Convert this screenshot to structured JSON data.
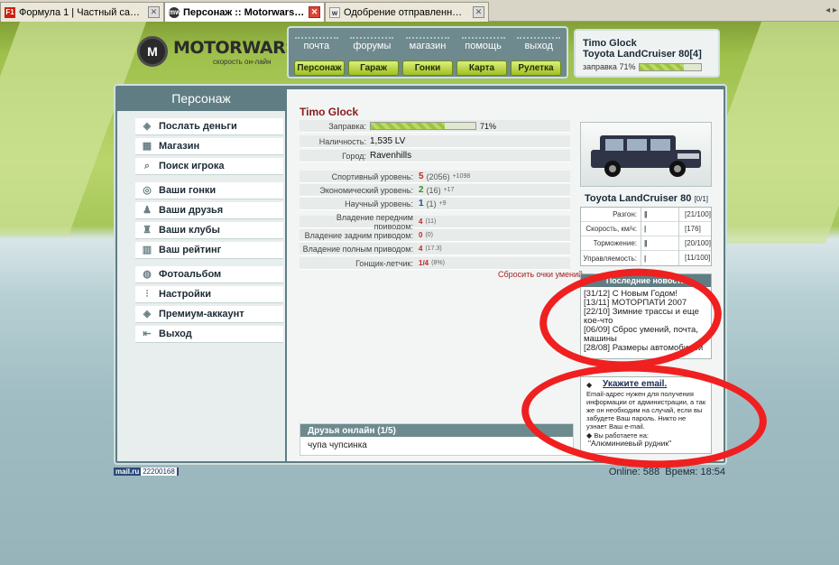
{
  "browser": {
    "tabs": [
      {
        "favicon": "F1",
        "title": "Формула 1 | Частный сайт о большин...",
        "active": false
      },
      {
        "favicon": "mw",
        "title": "Персонаж :: Motorwars.ru",
        "active": true
      },
      {
        "favicon": "w",
        "title": "Одобрение отправленных посетите...",
        "active": false
      }
    ],
    "tab_nav": "◂ ▸"
  },
  "logo": {
    "mark": "M",
    "title": "MOTORWARS.RU",
    "subtitle": "скорость он-лайн"
  },
  "topnav": {
    "links": [
      "почта",
      "форумы",
      "магазин",
      "помощь",
      "выход"
    ],
    "buttons": [
      "Персонаж",
      "Гараж",
      "Гонки",
      "Карта",
      "Рулетка"
    ]
  },
  "carbox": {
    "user": "Timo Glock",
    "car": "Toyota LandCruiser 80[4]",
    "fuel_label": "заправка 71%",
    "fuel_pct": 71
  },
  "sidebar": {
    "title": "Персонаж",
    "groups": [
      [
        {
          "icon": "money-icon",
          "glyph": "◈",
          "label": "Послать деньги"
        },
        {
          "icon": "shop-icon",
          "glyph": "▦",
          "label": "Магазин"
        },
        {
          "icon": "search-icon",
          "glyph": "⌕",
          "label": "Поиск игрока"
        }
      ],
      [
        {
          "icon": "wheel-icon",
          "glyph": "◎",
          "label": "Ваши гонки"
        },
        {
          "icon": "friends-icon",
          "glyph": "♟",
          "label": "Ваши друзья"
        },
        {
          "icon": "clubs-icon",
          "glyph": "♜",
          "label": "Ваши клубы"
        },
        {
          "icon": "rating-icon",
          "glyph": "▥",
          "label": "Ваш рейтинг"
        }
      ],
      [
        {
          "icon": "camera-icon",
          "glyph": "◍",
          "label": "Фотоальбом"
        },
        {
          "icon": "settings-icon",
          "glyph": "⫶",
          "label": "Настройки"
        },
        {
          "icon": "premium-icon",
          "glyph": "◈",
          "label": "Премиум-аккаунт"
        },
        {
          "icon": "exit-icon",
          "glyph": "⇤",
          "label": "Выход"
        }
      ]
    ]
  },
  "character": {
    "name": "Timo Glock",
    "fuel": {
      "label": "Заправка:",
      "pct": 71,
      "text": "71%"
    },
    "cash": {
      "label": "Наличность:",
      "value": "1,535 LV"
    },
    "city": {
      "label": "Город:",
      "value": "Ravenhills"
    },
    "levels": [
      {
        "label": "Спортивный уровень:",
        "value": "5",
        "paren": "(2056)",
        "delta": "+1098",
        "color": "red"
      },
      {
        "label": "Экономический уровень:",
        "value": "2",
        "paren": "(16)",
        "delta": "+17",
        "color": "green"
      },
      {
        "label": "Научный уровень:",
        "value": "1",
        "paren": "(1)",
        "delta": "+9",
        "color": "blue"
      }
    ],
    "skills": [
      {
        "label": "Владение передним приводом:",
        "value": "4",
        "paren": "(11)"
      },
      {
        "label": "Владение задним приводом:",
        "value": "0",
        "paren": "(0)"
      },
      {
        "label": "Владение полным приводом:",
        "value": "4",
        "paren": "(17.3)"
      }
    ],
    "racer": {
      "label": "Гонщик-летчик:",
      "value": "1/4",
      "paren": "(8%)"
    },
    "reset_link": "Сбросить очки умений"
  },
  "friends": {
    "title": "Друзья онлайн (1/5)",
    "names": "чупа чупсинка"
  },
  "car": {
    "model": "Toyota LandCruiser 80",
    "slot": "[0/1]",
    "stats": [
      {
        "label": "Разгон:",
        "ticks": "||",
        "value": "[21/100]"
      },
      {
        "label": "Скорость, км/ч:",
        "ticks": "|",
        "value": "[176]"
      },
      {
        "label": "Торможение:",
        "ticks": "||",
        "value": "[20/100]"
      },
      {
        "label": "Управляемость:",
        "ticks": "|",
        "value": "[11/100]"
      }
    ]
  },
  "news": {
    "title": "Последние новости",
    "items": [
      "[31/12] С Новым Годом!",
      "[13/11] МОТОРПАТИ 2007",
      "[22/10] Зимние трассы и еще кое-что",
      "[06/09] Сброс умений, почта, машины",
      "[28/08] Размеры автомобилей"
    ]
  },
  "email": {
    "title": "Укажите email.",
    "text": "Email-адрес нужен для получения информации от администрации, а так же он необходим на случай, если вы забудете Ваш пароль. Никто не узнает Ваш e-mail.",
    "work_label": "Вы работаете на:",
    "work_value": "\"Алюминиевый рудник\""
  },
  "footer": {
    "counter_label": "mail.ru",
    "counter_value": "22200168",
    "online": "Online: 588",
    "time": "Время: 18:54"
  },
  "colors": {
    "annotation": "#f02020",
    "panel": "#5f7d82",
    "accent_green": "#9fbf21"
  }
}
